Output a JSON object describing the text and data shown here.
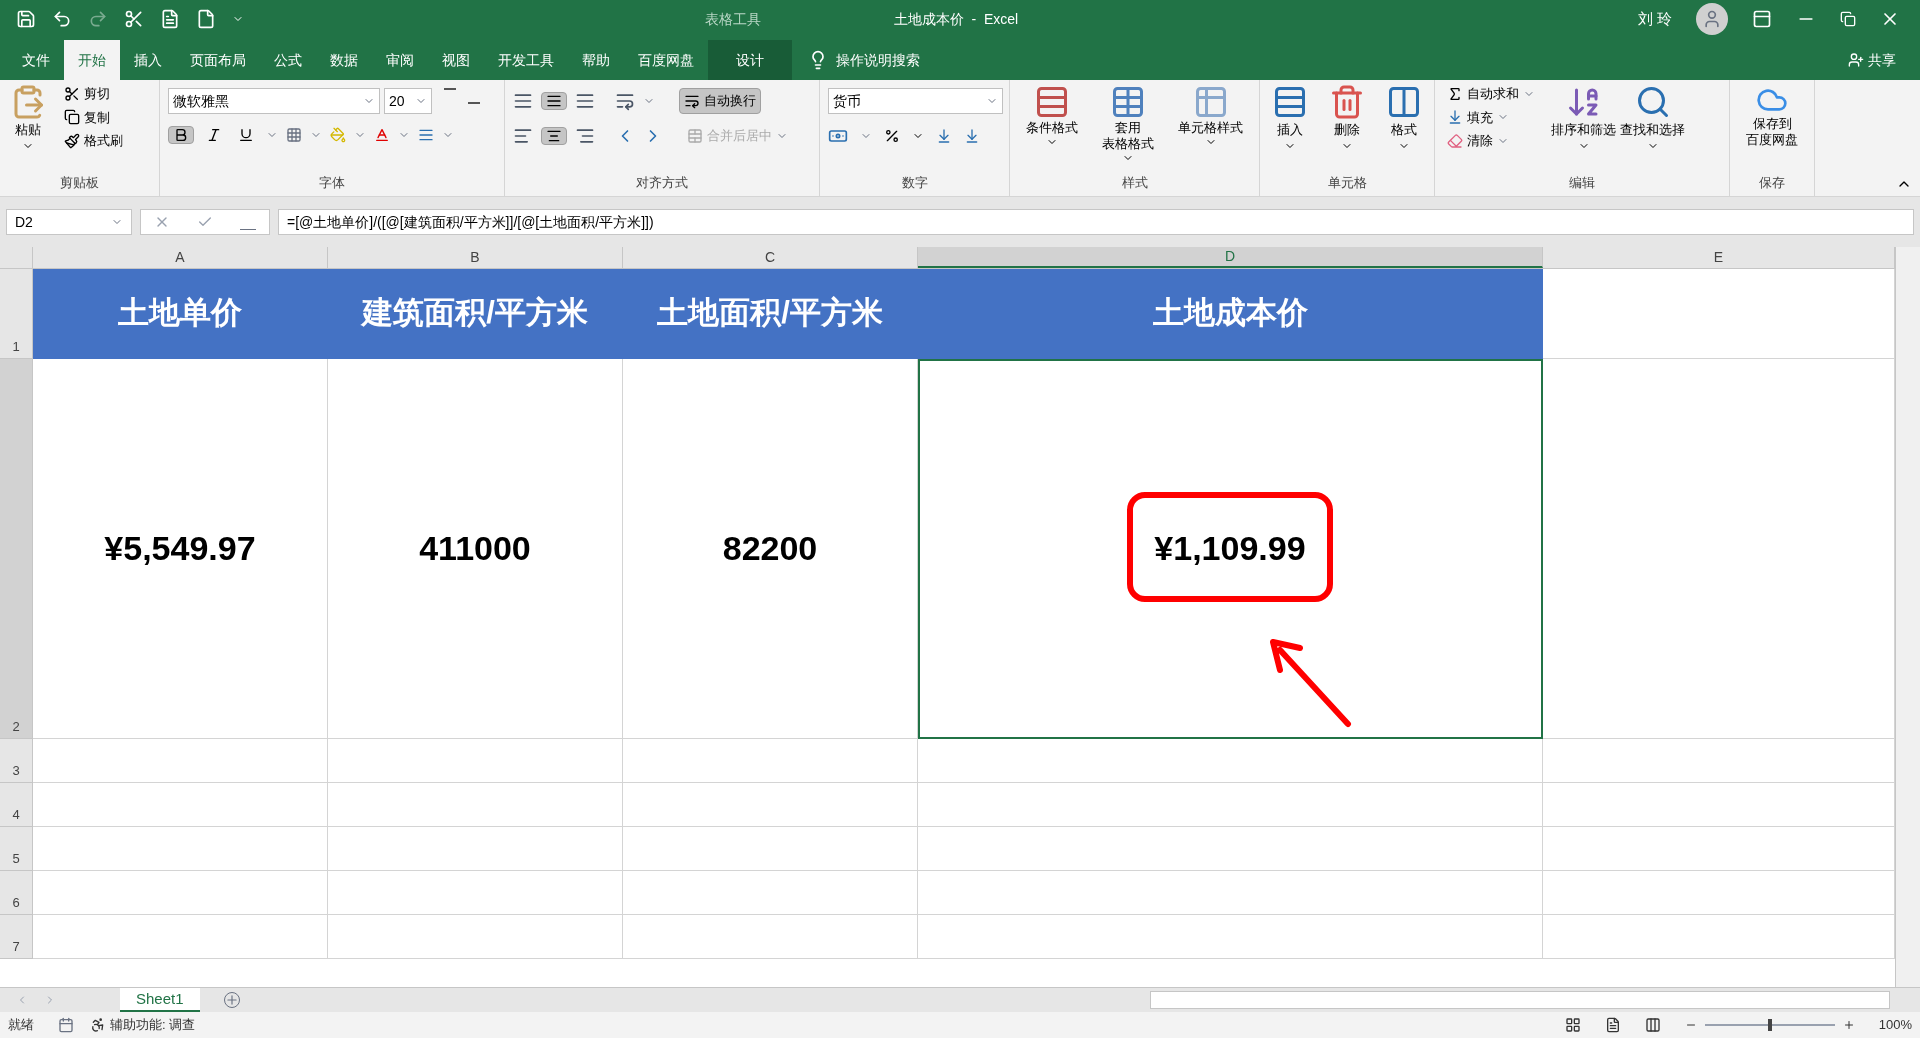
{
  "title_bar": {
    "context_label": "表格工具",
    "title": "土地成本价  -  Excel",
    "user": "刘 玲"
  },
  "tabs": [
    {
      "label": "文件",
      "selected": false
    },
    {
      "label": "开始",
      "selected": true
    },
    {
      "label": "插入",
      "selected": false
    },
    {
      "label": "页面布局",
      "selected": false
    },
    {
      "label": "公式",
      "selected": false
    },
    {
      "label": "数据",
      "selected": false
    },
    {
      "label": "审阅",
      "selected": false
    },
    {
      "label": "视图",
      "selected": false
    },
    {
      "label": "开发工具",
      "selected": false
    },
    {
      "label": "帮助",
      "selected": false
    },
    {
      "label": "百度网盘",
      "selected": false
    },
    {
      "label": "设计",
      "selected": false,
      "kind": "context"
    }
  ],
  "tell_me": "操作说明搜索",
  "share": "共享",
  "ribbon": {
    "clipboard": {
      "label": "剪贴板",
      "paste": "粘贴",
      "cut": "剪切",
      "copy": "复制",
      "format_painter": "格式刷"
    },
    "font": {
      "label": "字体",
      "font_name": "微软雅黑",
      "font_size": "20",
      "bold": true,
      "italic": false,
      "underline": false
    },
    "alignment": {
      "label": "对齐方式",
      "wrap_text": {
        "label": "自动换行",
        "on": true
      },
      "merge": {
        "label": "合并后居中",
        "disabled": true
      },
      "center": true
    },
    "number": {
      "label": "数字",
      "format": "货币"
    },
    "styles": {
      "label": "样式",
      "buttons": [
        {
          "kind": "conditional",
          "lines": [
            "条件格式"
          ]
        },
        {
          "kind": "table",
          "lines": [
            "套用",
            "表格格式"
          ]
        },
        {
          "kind": "cell",
          "lines": [
            "单元格样式"
          ]
        }
      ]
    },
    "cells": {
      "label": "单元格",
      "buttons": [
        {
          "kind": "insert",
          "label": "插入"
        },
        {
          "kind": "delete",
          "label": "删除"
        },
        {
          "kind": "format",
          "label": "格式"
        }
      ]
    },
    "editing": {
      "label": "编辑",
      "autosum": "自动求和",
      "fill": "填充",
      "clear": "清除",
      "sort": "排序和筛选",
      "find": "查找和选择"
    },
    "save": {
      "label": "保存",
      "button": [
        "保存到",
        "百度网盘"
      ]
    }
  },
  "formula_bar": {
    "name_box": "D2",
    "formula": "=[@土地单价]/([@[建筑面积/平方米]]/[@[土地面积/平方米]])"
  },
  "columns": [
    {
      "label": "A",
      "selected": false
    },
    {
      "label": "B",
      "selected": false
    },
    {
      "label": "C",
      "selected": false
    },
    {
      "label": "D",
      "selected": true
    },
    {
      "label": "E",
      "selected": false
    }
  ],
  "rows": [
    {
      "label": "1",
      "cells": [
        "土地单价",
        "建筑面积/平方米",
        "土地面积/平方米",
        "土地成本价"
      ]
    },
    {
      "label": "2",
      "cells": [
        "¥5,549.97",
        "411000",
        "82200",
        "¥1,109.99"
      ]
    },
    {
      "label": "3",
      "cells": []
    },
    {
      "label": "4",
      "cells": []
    },
    {
      "label": "5",
      "cells": []
    },
    {
      "label": "6",
      "cells": []
    },
    {
      "label": "7",
      "cells": []
    }
  ],
  "sheets": [
    {
      "label": "Sheet1",
      "selected": true
    }
  ],
  "status_bar": {
    "ready": "就绪",
    "accessibility": "辅助功能: 调查",
    "zoom": "100%",
    "zoom_slider": {
      "level": 0.5
    }
  }
}
